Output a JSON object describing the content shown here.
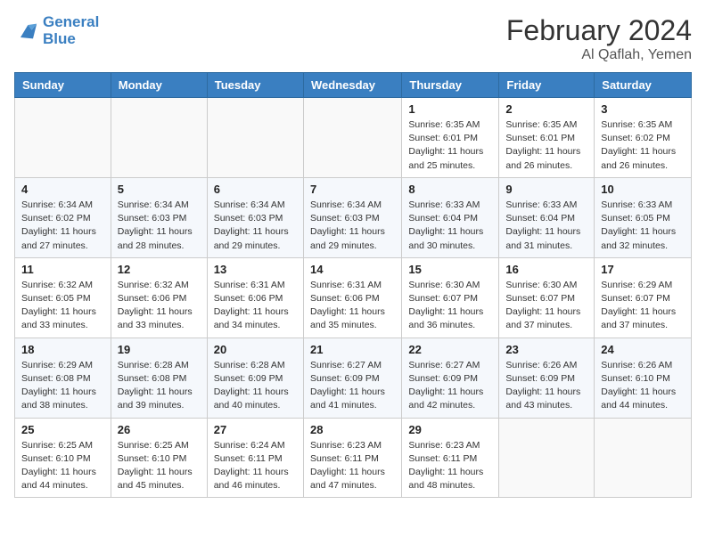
{
  "header": {
    "logo_line1": "General",
    "logo_line2": "Blue",
    "month_year": "February 2024",
    "location": "Al Qaflah, Yemen"
  },
  "days_of_week": [
    "Sunday",
    "Monday",
    "Tuesday",
    "Wednesday",
    "Thursday",
    "Friday",
    "Saturday"
  ],
  "weeks": [
    [
      {
        "day": "",
        "info": ""
      },
      {
        "day": "",
        "info": ""
      },
      {
        "day": "",
        "info": ""
      },
      {
        "day": "",
        "info": ""
      },
      {
        "day": "1",
        "info": "Sunrise: 6:35 AM\nSunset: 6:01 PM\nDaylight: 11 hours and 25 minutes."
      },
      {
        "day": "2",
        "info": "Sunrise: 6:35 AM\nSunset: 6:01 PM\nDaylight: 11 hours and 26 minutes."
      },
      {
        "day": "3",
        "info": "Sunrise: 6:35 AM\nSunset: 6:02 PM\nDaylight: 11 hours and 26 minutes."
      }
    ],
    [
      {
        "day": "4",
        "info": "Sunrise: 6:34 AM\nSunset: 6:02 PM\nDaylight: 11 hours and 27 minutes."
      },
      {
        "day": "5",
        "info": "Sunrise: 6:34 AM\nSunset: 6:03 PM\nDaylight: 11 hours and 28 minutes."
      },
      {
        "day": "6",
        "info": "Sunrise: 6:34 AM\nSunset: 6:03 PM\nDaylight: 11 hours and 29 minutes."
      },
      {
        "day": "7",
        "info": "Sunrise: 6:34 AM\nSunset: 6:03 PM\nDaylight: 11 hours and 29 minutes."
      },
      {
        "day": "8",
        "info": "Sunrise: 6:33 AM\nSunset: 6:04 PM\nDaylight: 11 hours and 30 minutes."
      },
      {
        "day": "9",
        "info": "Sunrise: 6:33 AM\nSunset: 6:04 PM\nDaylight: 11 hours and 31 minutes."
      },
      {
        "day": "10",
        "info": "Sunrise: 6:33 AM\nSunset: 6:05 PM\nDaylight: 11 hours and 32 minutes."
      }
    ],
    [
      {
        "day": "11",
        "info": "Sunrise: 6:32 AM\nSunset: 6:05 PM\nDaylight: 11 hours and 33 minutes."
      },
      {
        "day": "12",
        "info": "Sunrise: 6:32 AM\nSunset: 6:06 PM\nDaylight: 11 hours and 33 minutes."
      },
      {
        "day": "13",
        "info": "Sunrise: 6:31 AM\nSunset: 6:06 PM\nDaylight: 11 hours and 34 minutes."
      },
      {
        "day": "14",
        "info": "Sunrise: 6:31 AM\nSunset: 6:06 PM\nDaylight: 11 hours and 35 minutes."
      },
      {
        "day": "15",
        "info": "Sunrise: 6:30 AM\nSunset: 6:07 PM\nDaylight: 11 hours and 36 minutes."
      },
      {
        "day": "16",
        "info": "Sunrise: 6:30 AM\nSunset: 6:07 PM\nDaylight: 11 hours and 37 minutes."
      },
      {
        "day": "17",
        "info": "Sunrise: 6:29 AM\nSunset: 6:07 PM\nDaylight: 11 hours and 37 minutes."
      }
    ],
    [
      {
        "day": "18",
        "info": "Sunrise: 6:29 AM\nSunset: 6:08 PM\nDaylight: 11 hours and 38 minutes."
      },
      {
        "day": "19",
        "info": "Sunrise: 6:28 AM\nSunset: 6:08 PM\nDaylight: 11 hours and 39 minutes."
      },
      {
        "day": "20",
        "info": "Sunrise: 6:28 AM\nSunset: 6:09 PM\nDaylight: 11 hours and 40 minutes."
      },
      {
        "day": "21",
        "info": "Sunrise: 6:27 AM\nSunset: 6:09 PM\nDaylight: 11 hours and 41 minutes."
      },
      {
        "day": "22",
        "info": "Sunrise: 6:27 AM\nSunset: 6:09 PM\nDaylight: 11 hours and 42 minutes."
      },
      {
        "day": "23",
        "info": "Sunrise: 6:26 AM\nSunset: 6:09 PM\nDaylight: 11 hours and 43 minutes."
      },
      {
        "day": "24",
        "info": "Sunrise: 6:26 AM\nSunset: 6:10 PM\nDaylight: 11 hours and 44 minutes."
      }
    ],
    [
      {
        "day": "25",
        "info": "Sunrise: 6:25 AM\nSunset: 6:10 PM\nDaylight: 11 hours and 44 minutes."
      },
      {
        "day": "26",
        "info": "Sunrise: 6:25 AM\nSunset: 6:10 PM\nDaylight: 11 hours and 45 minutes."
      },
      {
        "day": "27",
        "info": "Sunrise: 6:24 AM\nSunset: 6:11 PM\nDaylight: 11 hours and 46 minutes."
      },
      {
        "day": "28",
        "info": "Sunrise: 6:23 AM\nSunset: 6:11 PM\nDaylight: 11 hours and 47 minutes."
      },
      {
        "day": "29",
        "info": "Sunrise: 6:23 AM\nSunset: 6:11 PM\nDaylight: 11 hours and 48 minutes."
      },
      {
        "day": "",
        "info": ""
      },
      {
        "day": "",
        "info": ""
      }
    ]
  ]
}
